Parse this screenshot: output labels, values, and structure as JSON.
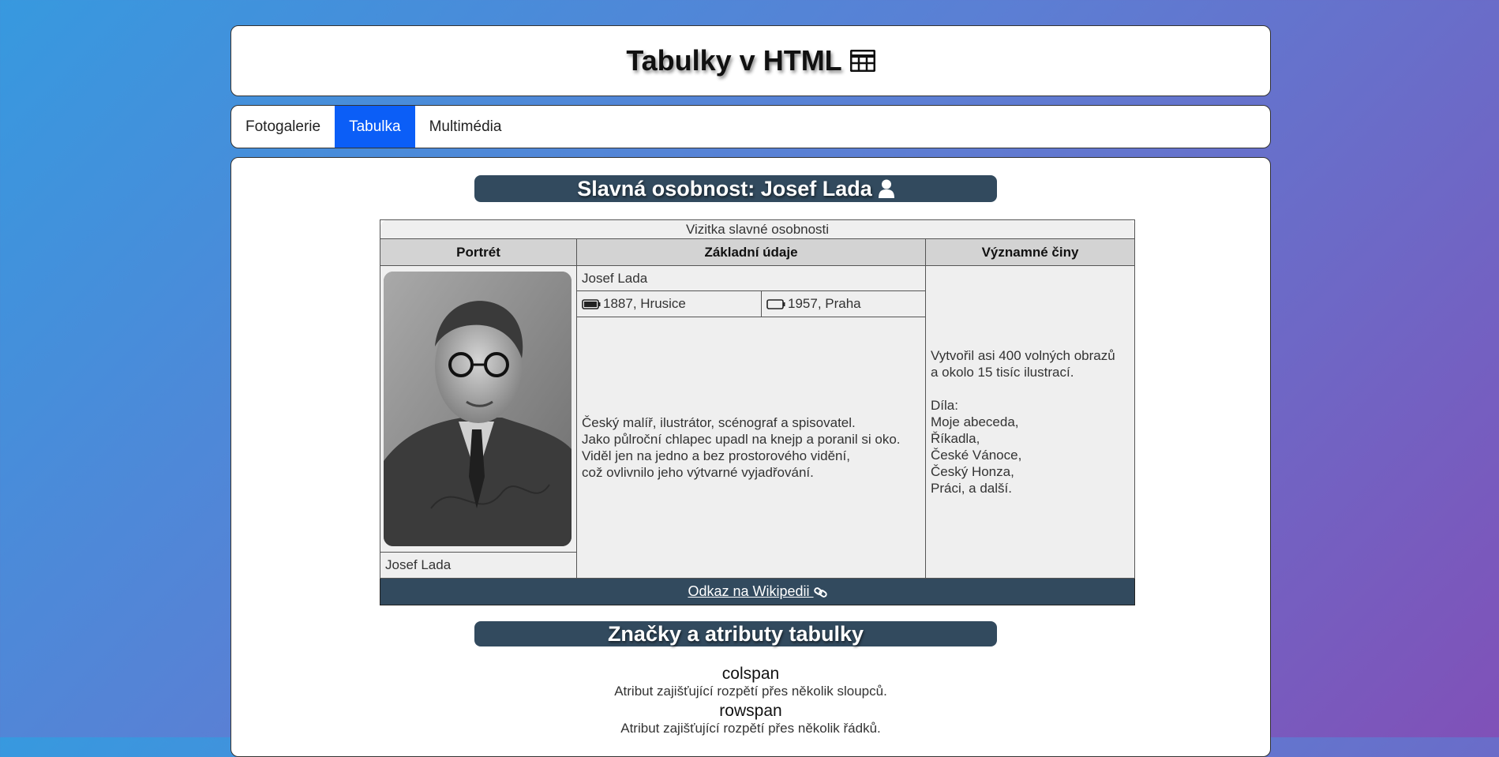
{
  "header": {
    "title": "Tabulky v HTML",
    "icon": "table-icon"
  },
  "nav": {
    "items": [
      {
        "label": "Fotogalerie",
        "active": false
      },
      {
        "label": "Tabulka",
        "active": true
      },
      {
        "label": "Multimédia",
        "active": false
      }
    ]
  },
  "sections": {
    "person_heading": "Slavná osobnost: Josef Lada",
    "attrs_heading": "Značky a atributy tabulky"
  },
  "card": {
    "caption": "Vizitka slavné osobnosti",
    "columns": [
      "Portrét",
      "Základní údaje",
      "Významné činy"
    ],
    "name": "Josef Lada",
    "born": "1887, Hrusice",
    "died": "1957, Praha",
    "bio_lines": [
      "Český malíř, ilustrátor, scénograf a spisovatel.",
      "Jako půlroční chlapec upadl na knejp a poranil si oko.",
      "Viděl jen na jedno a bez prostorového vidění,",
      "což ovlivnilo jeho výtvarné vyjadřování."
    ],
    "deeds_lines": [
      "Vytvořil asi 400 volných obrazů",
      "a okolo 15 tisíc ilustrací.",
      "",
      "Díla:",
      "Moje abeceda,",
      "Říkadla,",
      "České Vánoce,",
      "Český Honza,",
      "Práci, a další."
    ],
    "portrait_caption": "Josef Lada",
    "link_label": "Odkaz na Wikipedii"
  },
  "attributes": [
    {
      "name": "colspan",
      "desc": "Atribut zajišťující rozpětí přes několik sloupců."
    },
    {
      "name": "rowspan",
      "desc": "Atribut zajišťující rozpětí přes několik řádků."
    }
  ],
  "colors": {
    "nav_active": "#0b5ef7",
    "heading_bg": "#324a5e"
  }
}
